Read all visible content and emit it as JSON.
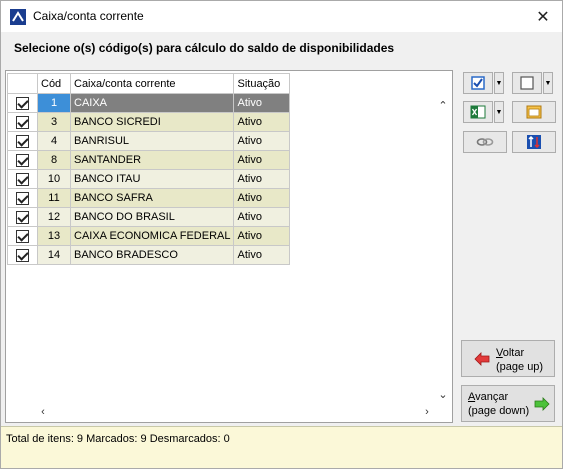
{
  "window": {
    "title": "Caixa/conta corrente",
    "close_glyph": "✕"
  },
  "header": {
    "text": "Selecione o(s) código(s) para cálculo do saldo de disponibilidades"
  },
  "grid": {
    "columns": {
      "cod": "Cód",
      "name": "Caixa/conta corrente",
      "status": "Situação"
    },
    "rows": [
      {
        "cod": "1",
        "name": "CAIXA",
        "status": "Ativo",
        "checked": true
      },
      {
        "cod": "3",
        "name": "BANCO SICREDI",
        "status": "Ativo",
        "checked": true
      },
      {
        "cod": "4",
        "name": "BANRISUL",
        "status": "Ativo",
        "checked": true
      },
      {
        "cod": "8",
        "name": "SANTANDER",
        "status": "Ativo",
        "checked": true
      },
      {
        "cod": "10",
        "name": "BANCO ITAU",
        "status": "Ativo",
        "checked": true
      },
      {
        "cod": "11",
        "name": "BANCO SAFRA",
        "status": "Ativo",
        "checked": true
      },
      {
        "cod": "12",
        "name": "BANCO DO BRASIL",
        "status": "Ativo",
        "checked": true
      },
      {
        "cod": "13",
        "name": "CAIXA ECONOMICA FEDERAL",
        "status": "Ativo",
        "checked": true
      },
      {
        "cod": "14",
        "name": "BANCO BRADESCO",
        "status": "Ativo",
        "checked": true
      }
    ]
  },
  "buttons": {
    "voltar_underlined": "V",
    "voltar_rest": "oltar",
    "voltar_sub": "(page up)",
    "avancar_underlined": "A",
    "avancar_rest": "vançar",
    "avancar_sub": "(page down)"
  },
  "status": {
    "text": "Total de itens: 9 Marcados: 9 Desmarcados: 0"
  },
  "colors": {
    "selected_row": "#808080",
    "selected_cod": "#3d8fd8",
    "row_odd": "#e8e8c8",
    "row_even": "#f0f0e0",
    "status_bg": "#fbf8d8"
  }
}
